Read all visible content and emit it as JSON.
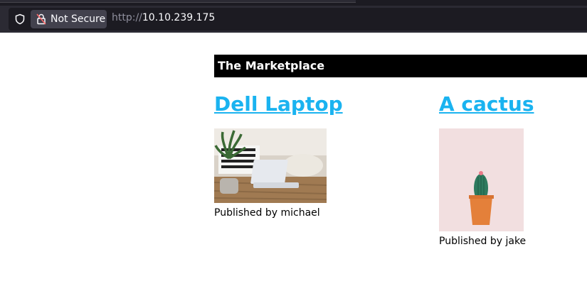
{
  "browser": {
    "security_label": "Not Secure",
    "url_protocol": "http://",
    "url_host": "10.10.239.175"
  },
  "site": {
    "header_title": "The Marketplace"
  },
  "listings": [
    {
      "title": "Dell Laptop",
      "byline": "Published by michael",
      "image_icon": "laptop-photo"
    },
    {
      "title": "A cactus",
      "byline": "Published by jake",
      "image_icon": "cactus-photo"
    }
  ]
}
